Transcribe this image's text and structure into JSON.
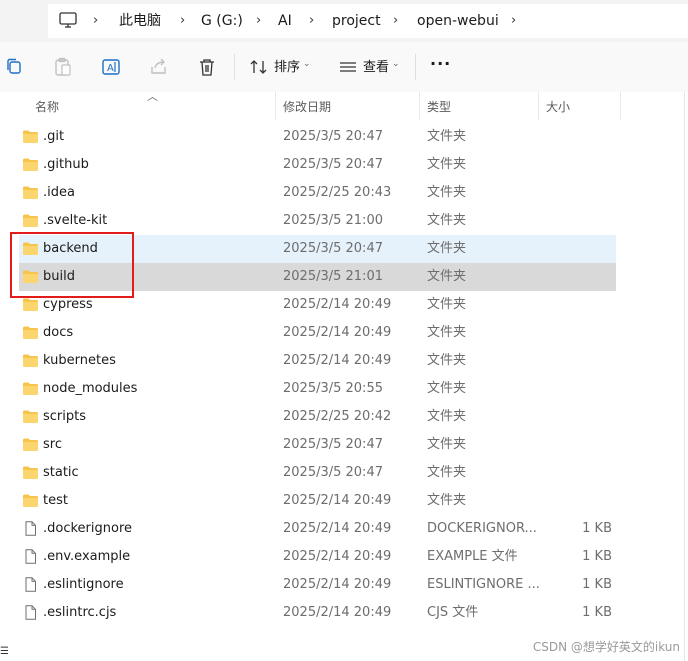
{
  "breadcrumbs": [
    "此电脑",
    "G (G:)",
    "AI",
    "project",
    "open-webui"
  ],
  "toolbar": {
    "sort_label": "排序",
    "view_label": "查看",
    "more_label": "···"
  },
  "columns": {
    "name": "名称",
    "date": "修改日期",
    "type": "类型",
    "size": "大小"
  },
  "rows": [
    {
      "name": ".git",
      "date": "2025/3/5 20:47",
      "type": "文件夹",
      "size": "",
      "icon": "folder-icon",
      "selection": "none"
    },
    {
      "name": ".github",
      "date": "2025/3/5 20:47",
      "type": "文件夹",
      "size": "",
      "icon": "folder-icon",
      "selection": "none"
    },
    {
      "name": ".idea",
      "date": "2025/2/25 20:43",
      "type": "文件夹",
      "size": "",
      "icon": "folder-icon",
      "selection": "none"
    },
    {
      "name": ".svelte-kit",
      "date": "2025/3/5 21:00",
      "type": "文件夹",
      "size": "",
      "icon": "folder-icon",
      "selection": "none"
    },
    {
      "name": "backend",
      "date": "2025/3/5 20:47",
      "type": "文件夹",
      "size": "",
      "icon": "folder-icon",
      "selection": "hover"
    },
    {
      "name": "build",
      "date": "2025/3/5 21:01",
      "type": "文件夹",
      "size": "",
      "icon": "folder-icon",
      "selection": "selected"
    },
    {
      "name": "cypress",
      "date": "2025/2/14 20:49",
      "type": "文件夹",
      "size": "",
      "icon": "folder-icon",
      "selection": "none"
    },
    {
      "name": "docs",
      "date": "2025/2/14 20:49",
      "type": "文件夹",
      "size": "",
      "icon": "folder-icon",
      "selection": "none"
    },
    {
      "name": "kubernetes",
      "date": "2025/2/14 20:49",
      "type": "文件夹",
      "size": "",
      "icon": "folder-icon",
      "selection": "none"
    },
    {
      "name": "node_modules",
      "date": "2025/3/5 20:55",
      "type": "文件夹",
      "size": "",
      "icon": "folder-icon",
      "selection": "none"
    },
    {
      "name": "scripts",
      "date": "2025/2/25 20:42",
      "type": "文件夹",
      "size": "",
      "icon": "folder-icon",
      "selection": "none"
    },
    {
      "name": "src",
      "date": "2025/3/5 20:47",
      "type": "文件夹",
      "size": "",
      "icon": "folder-icon",
      "selection": "none"
    },
    {
      "name": "static",
      "date": "2025/3/5 20:47",
      "type": "文件夹",
      "size": "",
      "icon": "folder-icon",
      "selection": "none"
    },
    {
      "name": "test",
      "date": "2025/2/14 20:49",
      "type": "文件夹",
      "size": "",
      "icon": "folder-icon",
      "selection": "none"
    },
    {
      "name": ".dockerignore",
      "date": "2025/2/14 20:49",
      "type": "DOCKERIGNOR...",
      "size": "1 KB",
      "icon": "file-icon",
      "selection": "none"
    },
    {
      "name": ".env.example",
      "date": "2025/2/14 20:49",
      "type": "EXAMPLE 文件",
      "size": "1 KB",
      "icon": "file-icon",
      "selection": "none"
    },
    {
      "name": ".eslintignore",
      "date": "2025/2/14 20:49",
      "type": "ESLINTIGNORE ...",
      "size": "1 KB",
      "icon": "file-icon",
      "selection": "none"
    },
    {
      "name": ".eslintrc.cjs",
      "date": "2025/2/14 20:49",
      "type": "CJS 文件",
      "size": "1 KB",
      "icon": "file-icon",
      "selection": "none"
    }
  ],
  "watermark": "CSDN @想学好英文的ikun",
  "colors": {
    "folder": "#f8c54c",
    "highlight": "#e31b1b",
    "hover_row": "#e6f2fb",
    "selected_row": "#d9d9d9"
  }
}
